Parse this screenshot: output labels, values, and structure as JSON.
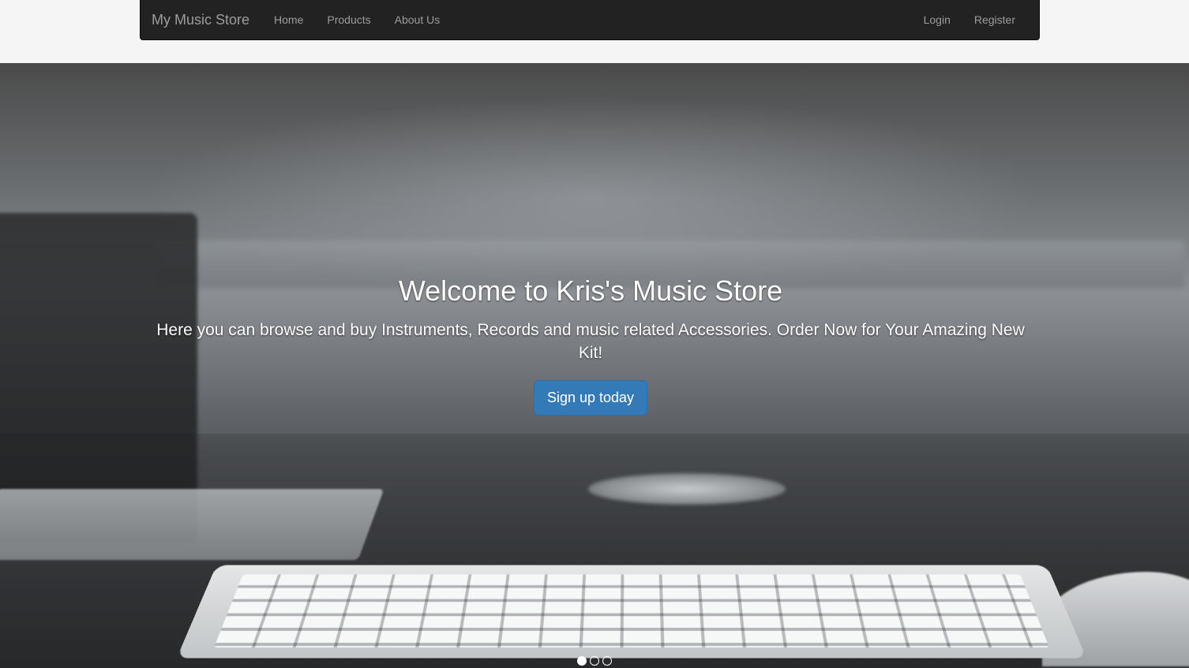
{
  "navbar": {
    "brand": "My Music Store",
    "left_links": [
      "Home",
      "Products",
      "About Us"
    ],
    "right_links": [
      "Login",
      "Register"
    ]
  },
  "hero": {
    "title": "Welcome to Kris's Music Store",
    "subtitle": "Here you can browse and buy Instruments, Records and music related Accessories. Order Now for Your Amazing New Kit!",
    "cta_label": "Sign up today"
  },
  "carousel": {
    "slide_count": 3,
    "active_index": 0
  },
  "colors": {
    "navbar_bg": "#222222",
    "nav_text": "#9d9d9d",
    "button_bg": "#337ab7",
    "page_bg": "#f5f5f5"
  }
}
